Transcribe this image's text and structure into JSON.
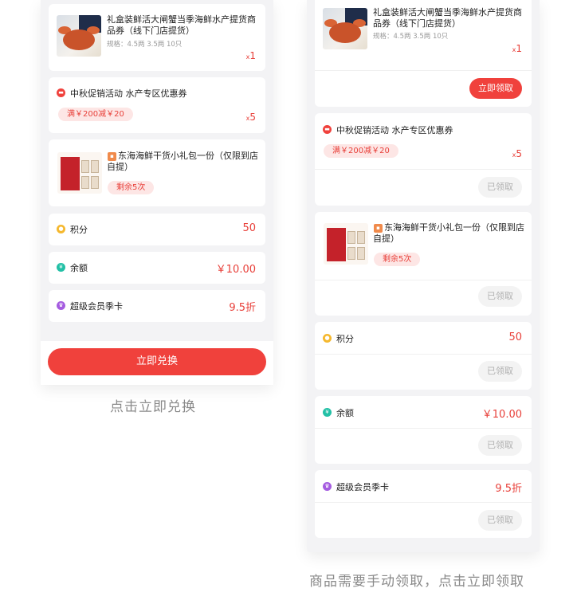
{
  "product": {
    "name": "礼盒装鲜活大闸蟹当季海鲜水产提货商品券（线下门店提货）",
    "spec": "规格：4.5两 3.5两 10只",
    "quantity_prefix": "x",
    "quantity": "1"
  },
  "coupon": {
    "icon": "coupon-icon",
    "title": "中秋促销活动 水产专区优惠券",
    "tag": "满￥200减￥20",
    "quantity_prefix": "x",
    "quantity": "5"
  },
  "gift": {
    "icon": "gift-icon",
    "title": "东海海鲜干货小礼包一份（仅限到店自提）",
    "tag": "剩余5次"
  },
  "points": {
    "icon": "points-icon",
    "label": "积分",
    "value": "50"
  },
  "balance": {
    "icon": "yuan-icon",
    "label": "余额",
    "value": "￥10.00"
  },
  "membership": {
    "icon": "crown-icon",
    "label": "超级会员季卡",
    "value": "9.5折"
  },
  "left_panel": {
    "redeem_button": "立即兑换",
    "caption": "点击立即兑换"
  },
  "right_panel": {
    "claim_button": "立即领取",
    "claimed_button": "已领取",
    "caption": "商品需要手动领取，点击立即领取"
  },
  "colors": {
    "accent": "#f0413c",
    "price": "#e8403a",
    "tag_bg": "#fde6e5",
    "page_bg": "#f3f3f5"
  }
}
